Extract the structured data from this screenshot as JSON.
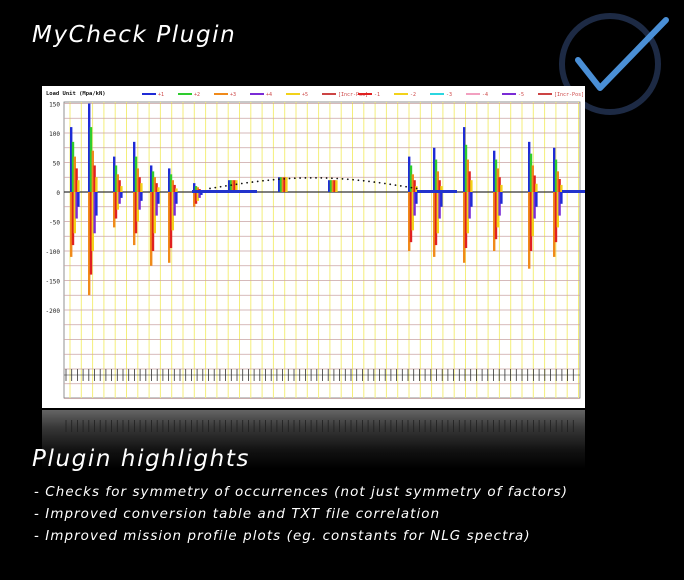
{
  "slide": {
    "title": "MyCheck Plugin",
    "logo_icon": "checkmark-circle-icon",
    "highlights_title": "Plugin highlights",
    "highlights": [
      "- Checks for symmetry of occurrences (not just symmetry of factors)",
      "- Improved conversion table and TXT file correlation",
      "- Improved mission profile plots (eg. constants for NLG spectra)"
    ]
  },
  "colors": {
    "background": "#000000",
    "text": "#ffffff",
    "logo_ring": "#1d2a44",
    "logo_check": "#4a8fd6",
    "grid_horizontal": "#c9a3a3",
    "grid_vertical": "#f4ee7a"
  },
  "chart_data": {
    "type": "bar",
    "ylabel": "Load Unit (Mpa/kN)",
    "yticks": [
      150,
      100,
      50,
      0,
      -50,
      -100,
      -150,
      -200
    ],
    "ylim": [
      -360,
      170
    ],
    "legend_positive": [
      "+1",
      "+2",
      "+3",
      "+4",
      "+5",
      "[Incr-Pos]"
    ],
    "legend_negative": [
      "-1",
      "-2",
      "-3",
      "-4",
      "-5",
      "[Incr-Pos]"
    ],
    "series_colors": [
      "#1f2bd6",
      "#2ecc2e",
      "#f08a1a",
      "#e02020",
      "#f2d21a",
      "#7a2bd6"
    ],
    "groups": [
      {
        "pos": [
          110,
          85,
          60,
          40,
          20
        ],
        "neg": [
          -110,
          -90,
          -70,
          -45,
          -25
        ]
      },
      {
        "pos": [
          150,
          110,
          70,
          45,
          25
        ],
        "neg": [
          -175,
          -140,
          -100,
          -70,
          -40
        ]
      },
      {
        "pos": [
          60,
          45,
          30,
          20,
          10
        ],
        "neg": [
          -60,
          -45,
          -30,
          -20,
          -10
        ]
      },
      {
        "pos": [
          85,
          60,
          40,
          25,
          15
        ],
        "neg": [
          -90,
          -70,
          -50,
          -30,
          -15
        ]
      },
      {
        "pos": [
          45,
          35,
          25,
          15,
          8
        ],
        "neg": [
          -125,
          -100,
          -70,
          -40,
          -20
        ]
      },
      {
        "pos": [
          40,
          30,
          20,
          12,
          6
        ],
        "neg": [
          -120,
          -95,
          -65,
          -40,
          -20
        ]
      },
      {
        "pos": [
          15,
          10,
          8,
          5,
          3
        ],
        "neg": [
          -25,
          -20,
          -15,
          -10,
          -5
        ]
      },
      {
        "pos": [
          20,
          20,
          20,
          20,
          20
        ],
        "neg": [
          0,
          0,
          0,
          0,
          0
        ]
      },
      {
        "pos": [
          25,
          25,
          25,
          25,
          25
        ],
        "neg": [
          0,
          0,
          0,
          0,
          0
        ]
      },
      {
        "pos": [
          20,
          20,
          20,
          20,
          20
        ],
        "neg": [
          0,
          0,
          0,
          0,
          0
        ]
      },
      {
        "pos": [
          60,
          45,
          30,
          20,
          10
        ],
        "neg": [
          -100,
          -85,
          -65,
          -40,
          -20
        ]
      },
      {
        "pos": [
          75,
          55,
          35,
          20,
          10
        ],
        "neg": [
          -110,
          -90,
          -70,
          -45,
          -25
        ]
      },
      {
        "pos": [
          110,
          80,
          55,
          35,
          20
        ],
        "neg": [
          -120,
          -95,
          -70,
          -45,
          -25
        ]
      },
      {
        "pos": [
          70,
          55,
          40,
          25,
          12
        ],
        "neg": [
          -100,
          -80,
          -60,
          -40,
          -20
        ]
      },
      {
        "pos": [
          85,
          65,
          45,
          28,
          14
        ],
        "neg": [
          -130,
          -100,
          -75,
          -45,
          -25
        ]
      },
      {
        "pos": [
          75,
          55,
          35,
          22,
          12
        ],
        "neg": [
          -110,
          -85,
          -60,
          -40,
          -20
        ]
      }
    ]
  }
}
